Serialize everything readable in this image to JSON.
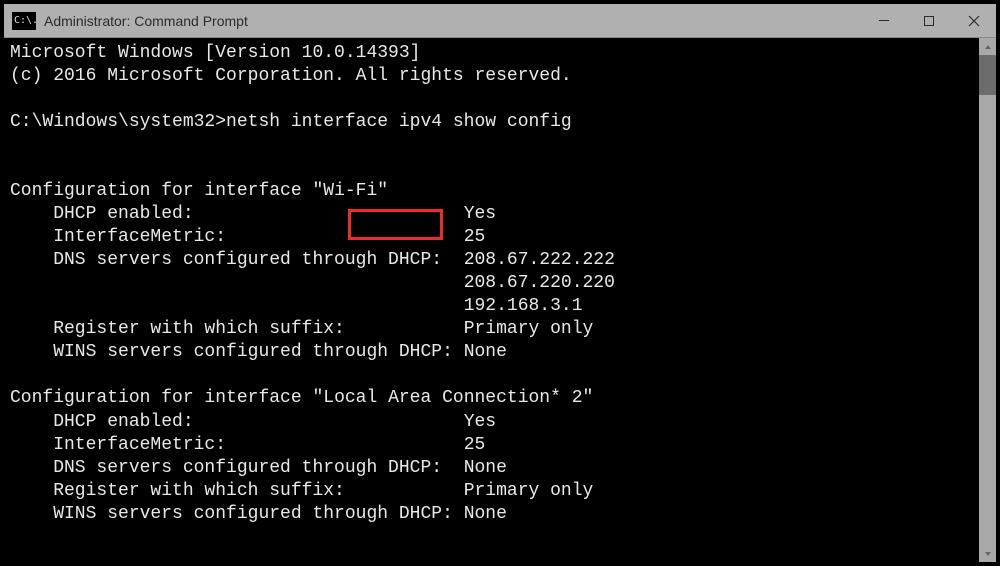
{
  "window": {
    "title": "Administrator: Command Prompt",
    "icon_glyph": "C:\\."
  },
  "terminal": {
    "os_line": "Microsoft Windows [Version 10.0.14393]",
    "copyright_line": "(c) 2016 Microsoft Corporation. All rights reserved.",
    "prompt_path": "C:\\Windows\\system32>",
    "command": "netsh interface ipv4 show config",
    "interfaces": [
      {
        "name": "Wi-Fi",
        "dhcp_enabled": "Yes",
        "interface_metric": "25",
        "dns_servers": [
          "208.67.222.222",
          "208.67.220.220",
          "192.168.3.1"
        ],
        "register_suffix": "Primary only",
        "wins": "None",
        "highlighted": true
      },
      {
        "name": "Local Area Connection* 2",
        "dhcp_enabled": "Yes",
        "interface_metric": "25",
        "dns_servers": "None",
        "register_suffix": "Primary only",
        "wins": "None",
        "highlighted": false
      }
    ]
  }
}
